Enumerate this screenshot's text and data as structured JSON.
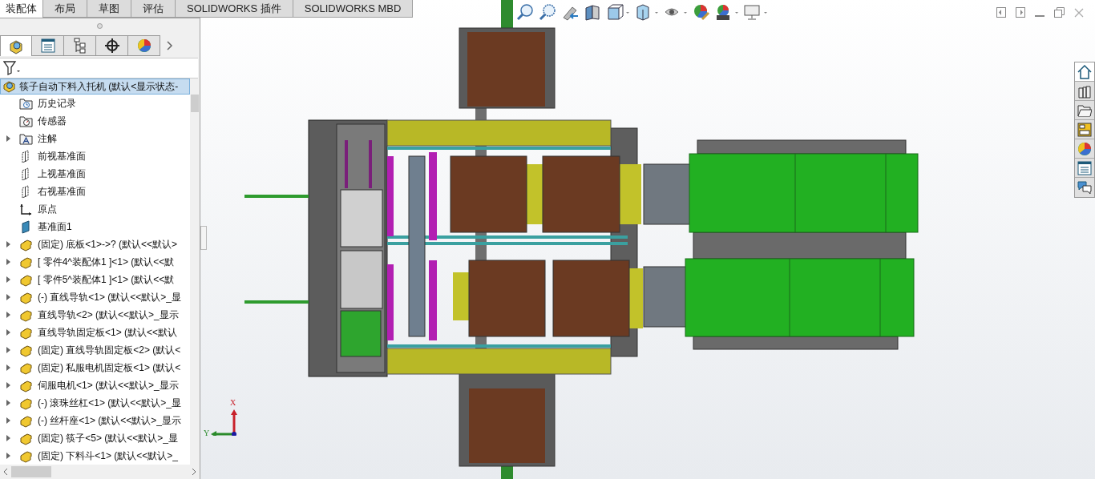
{
  "command_tabs": [
    {
      "label": "装配体",
      "selected": true
    },
    {
      "label": "布局",
      "selected": false
    },
    {
      "label": "草图",
      "selected": false
    },
    {
      "label": "评估",
      "selected": false
    },
    {
      "label": "SOLIDWORKS 插件",
      "selected": false
    },
    {
      "label": "SOLIDWORKS MBD",
      "selected": false
    }
  ],
  "panel_tabs": [
    {
      "kind": "feature-tree",
      "selected": true
    },
    {
      "kind": "property",
      "selected": false
    },
    {
      "kind": "config",
      "selected": false
    },
    {
      "kind": "dimxpert",
      "selected": false
    },
    {
      "kind": "appearance",
      "selected": false
    }
  ],
  "tree": {
    "root": {
      "label": "筷子自动下料入托机  (默认<显示状态-",
      "selected": true
    },
    "items": [
      {
        "kind": "history",
        "label": "历史记录",
        "expandable": false,
        "selected": false
      },
      {
        "kind": "sensor",
        "label": "传感器",
        "expandable": false,
        "selected": false
      },
      {
        "kind": "annotation",
        "label": "注解",
        "expandable": true,
        "selected": false
      },
      {
        "kind": "plane",
        "label": "前视基准面",
        "expandable": false,
        "selected": false
      },
      {
        "kind": "plane",
        "label": "上视基准面",
        "expandable": false,
        "selected": false
      },
      {
        "kind": "plane",
        "label": "右视基准面",
        "expandable": false,
        "selected": false
      },
      {
        "kind": "origin",
        "label": "原点",
        "expandable": false,
        "selected": false
      },
      {
        "kind": "plane-solid",
        "label": "基准面1",
        "expandable": false,
        "selected": false
      },
      {
        "kind": "part",
        "label": "(固定) 底板<1>->? (默认<<默认>",
        "expandable": true,
        "selected": false
      },
      {
        "kind": "part",
        "label": "[ 零件4^装配体1 ]<1> (默认<<默",
        "expandable": true,
        "selected": false
      },
      {
        "kind": "part",
        "label": "[ 零件5^装配体1 ]<1> (默认<<默",
        "expandable": true,
        "selected": false
      },
      {
        "kind": "part",
        "label": "(-) 直线导轨<1> (默认<<默认>_显",
        "expandable": true,
        "selected": false
      },
      {
        "kind": "part",
        "label": "直线导轨<2> (默认<<默认>_显示",
        "expandable": true,
        "selected": false
      },
      {
        "kind": "part",
        "label": "直线导轨固定板<1> (默认<<默认",
        "expandable": true,
        "selected": false
      },
      {
        "kind": "part",
        "label": "(固定) 直线导轨固定板<2> (默认<",
        "expandable": true,
        "selected": false
      },
      {
        "kind": "part",
        "label": "(固定) 私服电机固定板<1> (默认<",
        "expandable": true,
        "selected": false
      },
      {
        "kind": "part",
        "label": "伺服电机<1> (默认<<默认>_显示",
        "expandable": true,
        "selected": false
      },
      {
        "kind": "part",
        "label": "(-) 滚珠丝杠<1> (默认<<默认>_显",
        "expandable": true,
        "selected": false
      },
      {
        "kind": "part",
        "label": "(-) 丝杆座<1> (默认<<默认>_显示",
        "expandable": true,
        "selected": false
      },
      {
        "kind": "part",
        "label": "(固定) 筷子<5> (默认<<默认>_显",
        "expandable": true,
        "selected": false
      },
      {
        "kind": "part",
        "label": "(固定) 下料斗<1> (默认<<默认>_",
        "expandable": true,
        "selected": false
      }
    ]
  },
  "triad": {
    "x_label": "X",
    "y_label": "Y"
  }
}
